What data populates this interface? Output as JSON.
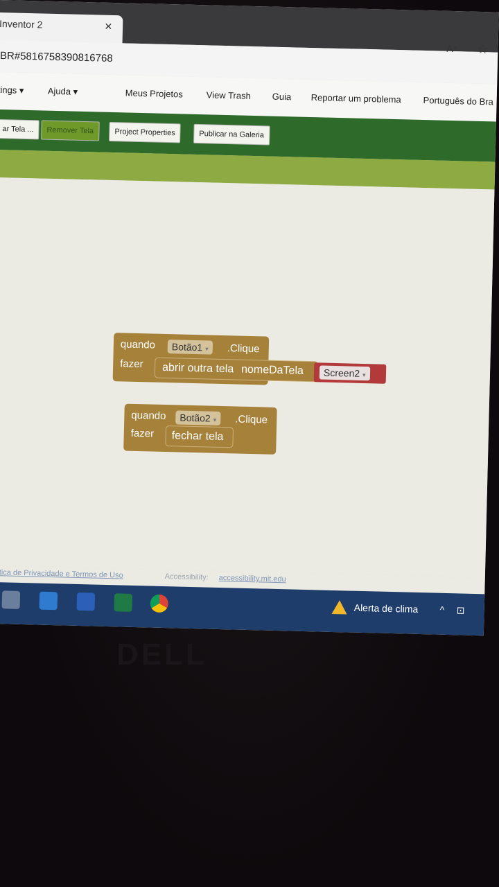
{
  "browser": {
    "tab_title": "Inventor 2",
    "close_icon": "×",
    "url": "BR#5816758390816768",
    "reader_icon": "A⁴",
    "favorite_icon": "☆"
  },
  "menubar": {
    "items": [
      "tings ▾",
      "Ajuda ▾",
      "Meus Projetos",
      "View Trash",
      "Guia",
      "Reportar um problema",
      "Português do Bra"
    ]
  },
  "toolbar": {
    "buttons": [
      "ar Tela ...",
      "Remover Tela",
      "Project Properties",
      "Publicar na Galeria"
    ]
  },
  "blocks": {
    "block1": {
      "when": "quando",
      "component": "Botão1",
      "event": ".Clique",
      "do": "fazer",
      "call": "abrir outra tela",
      "param": "nomeDaTela",
      "value": "Screen2"
    },
    "block2": {
      "when": "quando",
      "component": "Botão2",
      "event": ".Clique",
      "do": "fazer",
      "call": "fechar tela"
    },
    "dropdown_icon": "▾"
  },
  "footer": {
    "privacy": "Política de Privacidade e Termos de Uso",
    "accessibility_label": "Accessibility:",
    "accessibility_link": "accessibility.mit.edu"
  },
  "taskbar": {
    "weather": "Alerta de clima",
    "chevron_icon": "^"
  },
  "bezel_brand": "DELL"
}
